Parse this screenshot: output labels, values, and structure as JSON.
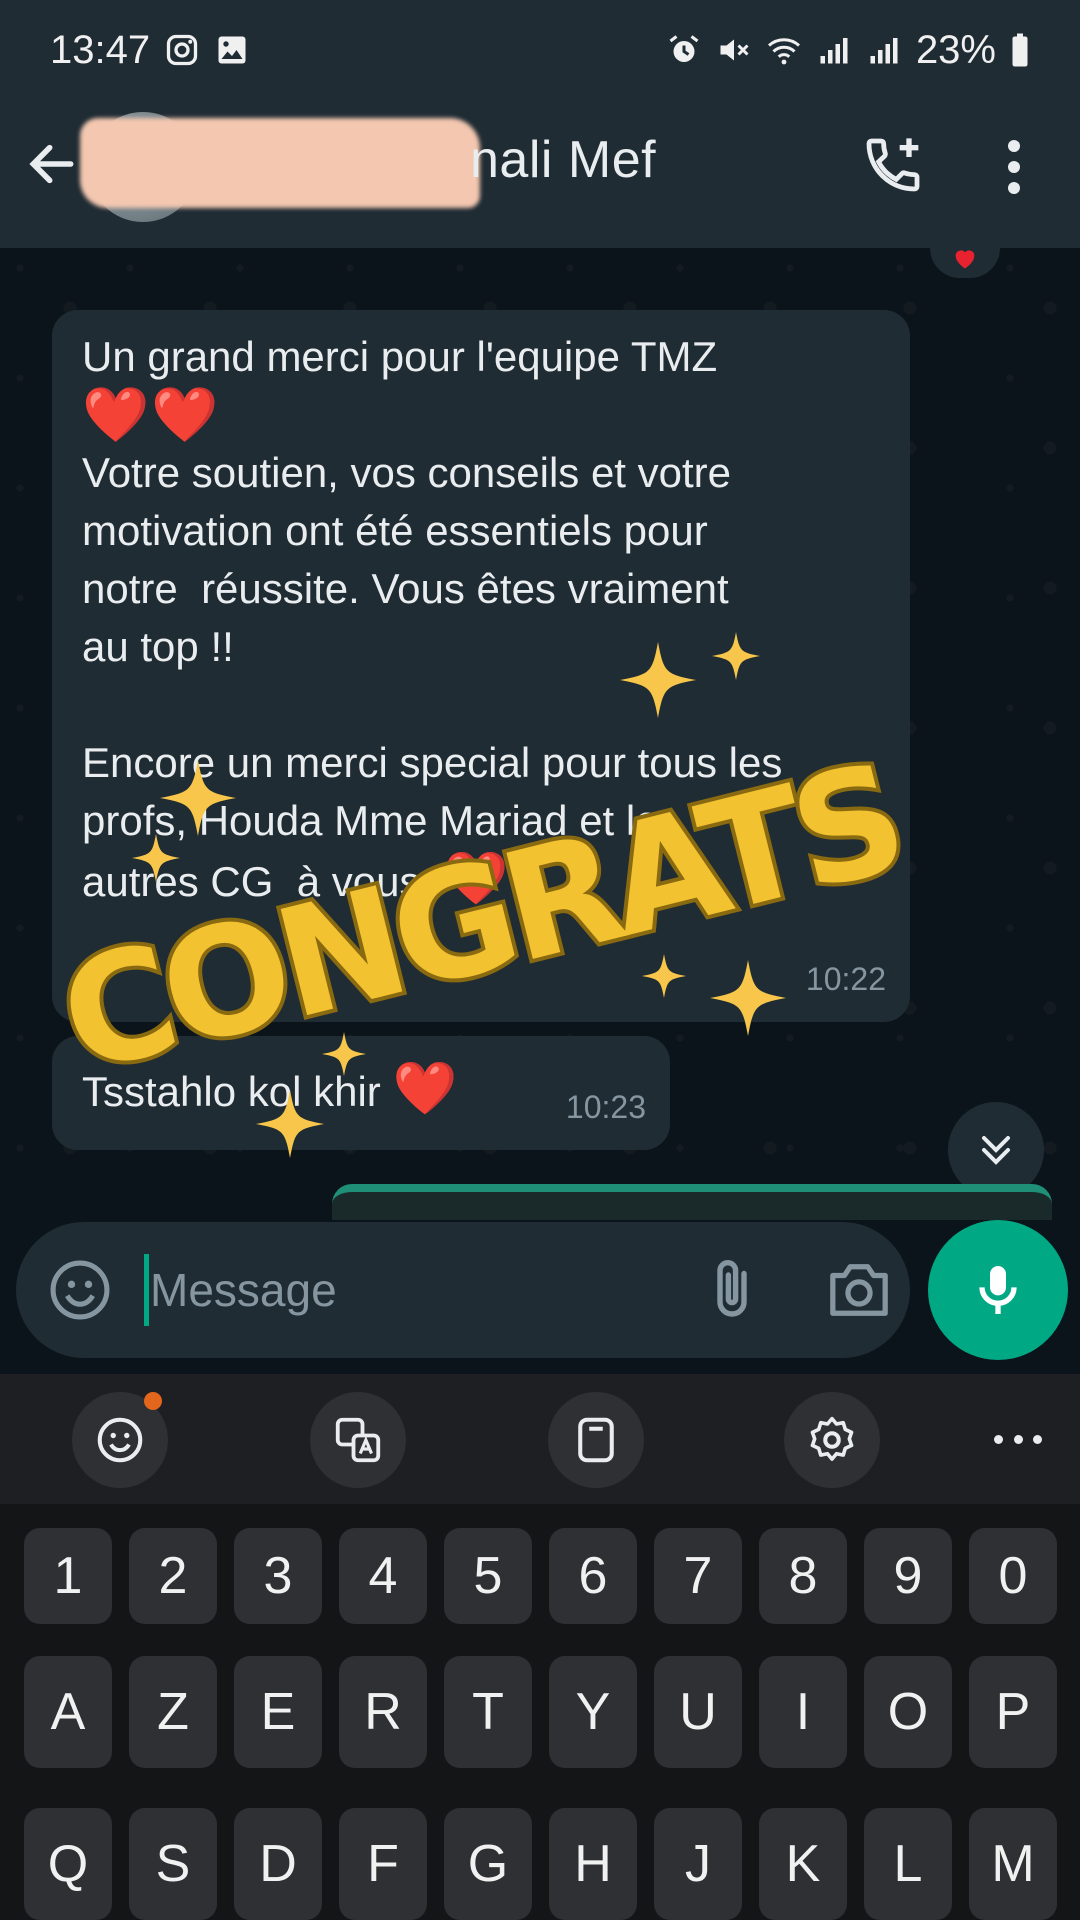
{
  "status_bar": {
    "time": "13:47",
    "battery": "23%",
    "icons_left": [
      "instagram-icon",
      "image-icon"
    ],
    "icons_right": [
      "alarm-icon",
      "mute-icon",
      "wifi-icon",
      "signal-icon",
      "signal-icon",
      "battery-icon"
    ]
  },
  "header": {
    "contact_name": "nali Mef",
    "name_partially_redacted": true,
    "icons": [
      "back-arrow-icon",
      "add-call-icon",
      "more-vert-icon"
    ]
  },
  "messages": [
    {
      "line1": "Un grand merci pour l'equipe TMZ",
      "hearts": "❤️❤️",
      "body": "Votre soutien, vos conseils et votre\nmotivation ont été essentiels pour\nnotre  réussite. Vous êtes vraiment\nau top !!\n\nEncore un merci special pour tous les\nprofs, Houda Mme Mariad et les\nautres CG  à vous, ",
      "heart_end": "❤️",
      "time": "10:22"
    },
    {
      "text": "Tsstahlo kol khir ",
      "heart_end": "❤️",
      "time": "10:23"
    }
  ],
  "sticker": {
    "text": "CONGRATS",
    "color_fill": "#f2c230",
    "color_outline": "#8a6a10",
    "sparkle_color": "#f7c64a"
  },
  "input": {
    "placeholder": "Message"
  },
  "keyboard": {
    "toolbar_icons": [
      "emoji-icon",
      "translate-icon",
      "clipboard-icon",
      "settings-icon",
      "more-icon"
    ],
    "row_numbers": [
      "1",
      "2",
      "3",
      "4",
      "5",
      "6",
      "7",
      "8",
      "9",
      "0"
    ],
    "row_1": [
      "A",
      "Z",
      "E",
      "R",
      "T",
      "Y",
      "U",
      "I",
      "O",
      "P"
    ],
    "row_2": [
      "Q",
      "S",
      "D",
      "F",
      "G",
      "H",
      "J",
      "K",
      "L",
      "M"
    ]
  },
  "colors": {
    "accent": "#00a884",
    "bubble": "#202c33",
    "header": "#1f2c34",
    "background": "#0b141a",
    "heart": "#e8232f"
  }
}
